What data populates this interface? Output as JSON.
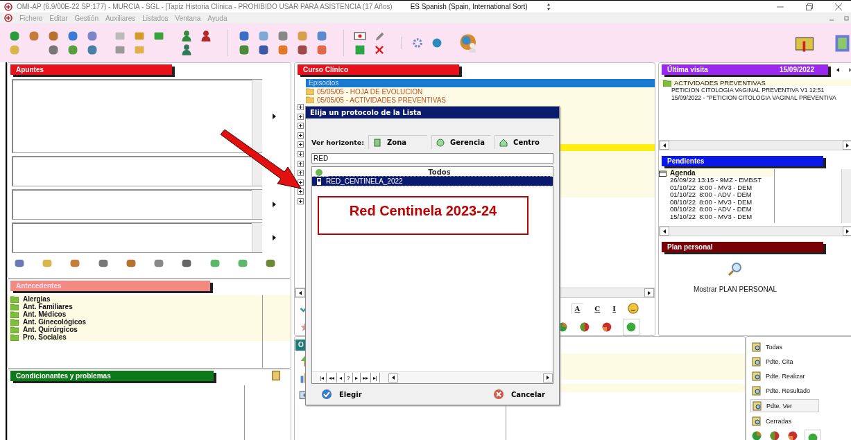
{
  "window": {
    "title": "OMI-AP (6.9/00E-22 SP:177) - MURCIA - SGL - [Tapiz Historia Clínica - PROHIBIDO USAR PARA ASISTENCIA (17 Años)",
    "language": "ES Spanish (Spain, International Sort)"
  },
  "menu": [
    "Fichero",
    "Editar",
    "Gestión",
    "Auxiliares",
    "Listados",
    "Ventana",
    "Ayuda"
  ],
  "apuntes": {
    "title": "Apuntes"
  },
  "antecedentes": {
    "title": "Antecedentes",
    "items": [
      "Alergias",
      "Ant. Familiares",
      "Ant. Médicos",
      "Ant. Ginecológicos",
      "Ant. Quirúrgicos",
      "Pro. Sociales"
    ]
  },
  "condicionantes": {
    "title": "Condicionantes y problemas"
  },
  "curso_clinico": {
    "title": "Curso Clínico",
    "tree_header": "Episodios",
    "episodes": [
      "05/05/05 - HOJA DE EVOLUCION",
      "05/05/05 - ACTIVIDADES PREVENTIVAS"
    ],
    "format_buttons": [
      "A",
      "C",
      "I"
    ]
  },
  "ultima_visita": {
    "title": "Última visita",
    "date": "15/09/2022",
    "folder": "ACTIVIDADES PREVENTIVAS",
    "lines": [
      "PETICION CITOLOGIA VAGINAL PREVENTIVA V1 12:51",
      "15/09/2022 - \"PETICION CITOLOGIA VAGINAL PREVENTIVA"
    ]
  },
  "pendientes": {
    "title": "Pendientes",
    "group": "Agenda",
    "entries": [
      "26/09/22 13:15 - 9MZ - EMBST",
      "01/10/22  8:00 - MV3 - DEM",
      "01/10/22  8:00 - ADV - DEM",
      "08/10/22  8:00 - MV3 - DEM",
      "08/10/22  8:00 - ADV - DEM",
      "15/10/22  8:00 - MV3 - DEM"
    ]
  },
  "plan_personal": {
    "title": "Plan personal",
    "action": "Mostrar PLAN PERSONAL"
  },
  "lower_panel": {
    "tab": "O"
  },
  "filters": [
    {
      "label": "Todas",
      "selected": false
    },
    {
      "label": "Pdte. Cita",
      "selected": false
    },
    {
      "label": "Pdte. Realizar",
      "selected": false
    },
    {
      "label": "Pdte. Resultado",
      "selected": false
    },
    {
      "label": "Pdte. Ver",
      "selected": true
    },
    {
      "label": "Cerradas",
      "selected": false
    }
  ],
  "dialog": {
    "title": "Elija un protocolo de la Lista",
    "horizon_label": "Ver horizonte:",
    "horizons": [
      "Zona",
      "Gerencia",
      "Centro"
    ],
    "search": {
      "value": "RED"
    },
    "list_header": "Todos",
    "rows": [
      {
        "label": "RED_CENTINELA_2022",
        "selected": true
      }
    ],
    "nav": [
      "|◂",
      "◂◂",
      "◂",
      "?",
      "▸",
      "▸▸",
      "▸|"
    ],
    "ok": "Elegir",
    "cancel": "Cancelar"
  },
  "annotation": {
    "text": "Red Centinela 2023-24"
  }
}
